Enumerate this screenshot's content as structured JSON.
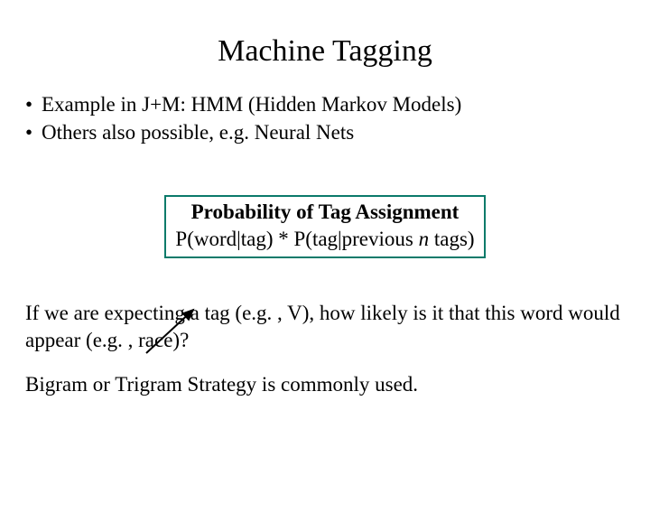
{
  "title": "Machine Tagging",
  "bullets": {
    "b1": "Example in J+M: HMM (Hidden Markov Models)",
    "b2": "Others also possible, e.g. Neural Nets"
  },
  "box": {
    "header": "Probability of Tag Assignment",
    "formula_a": "P(word|tag) * P(tag|previous ",
    "formula_n": "n",
    "formula_b": " tags)"
  },
  "para1": "If we are expecting a tag (e.g. , V), how likely is it that this word would appear (e.g. , race)?",
  "para2": "Bigram or Trigram Strategy is commonly used."
}
